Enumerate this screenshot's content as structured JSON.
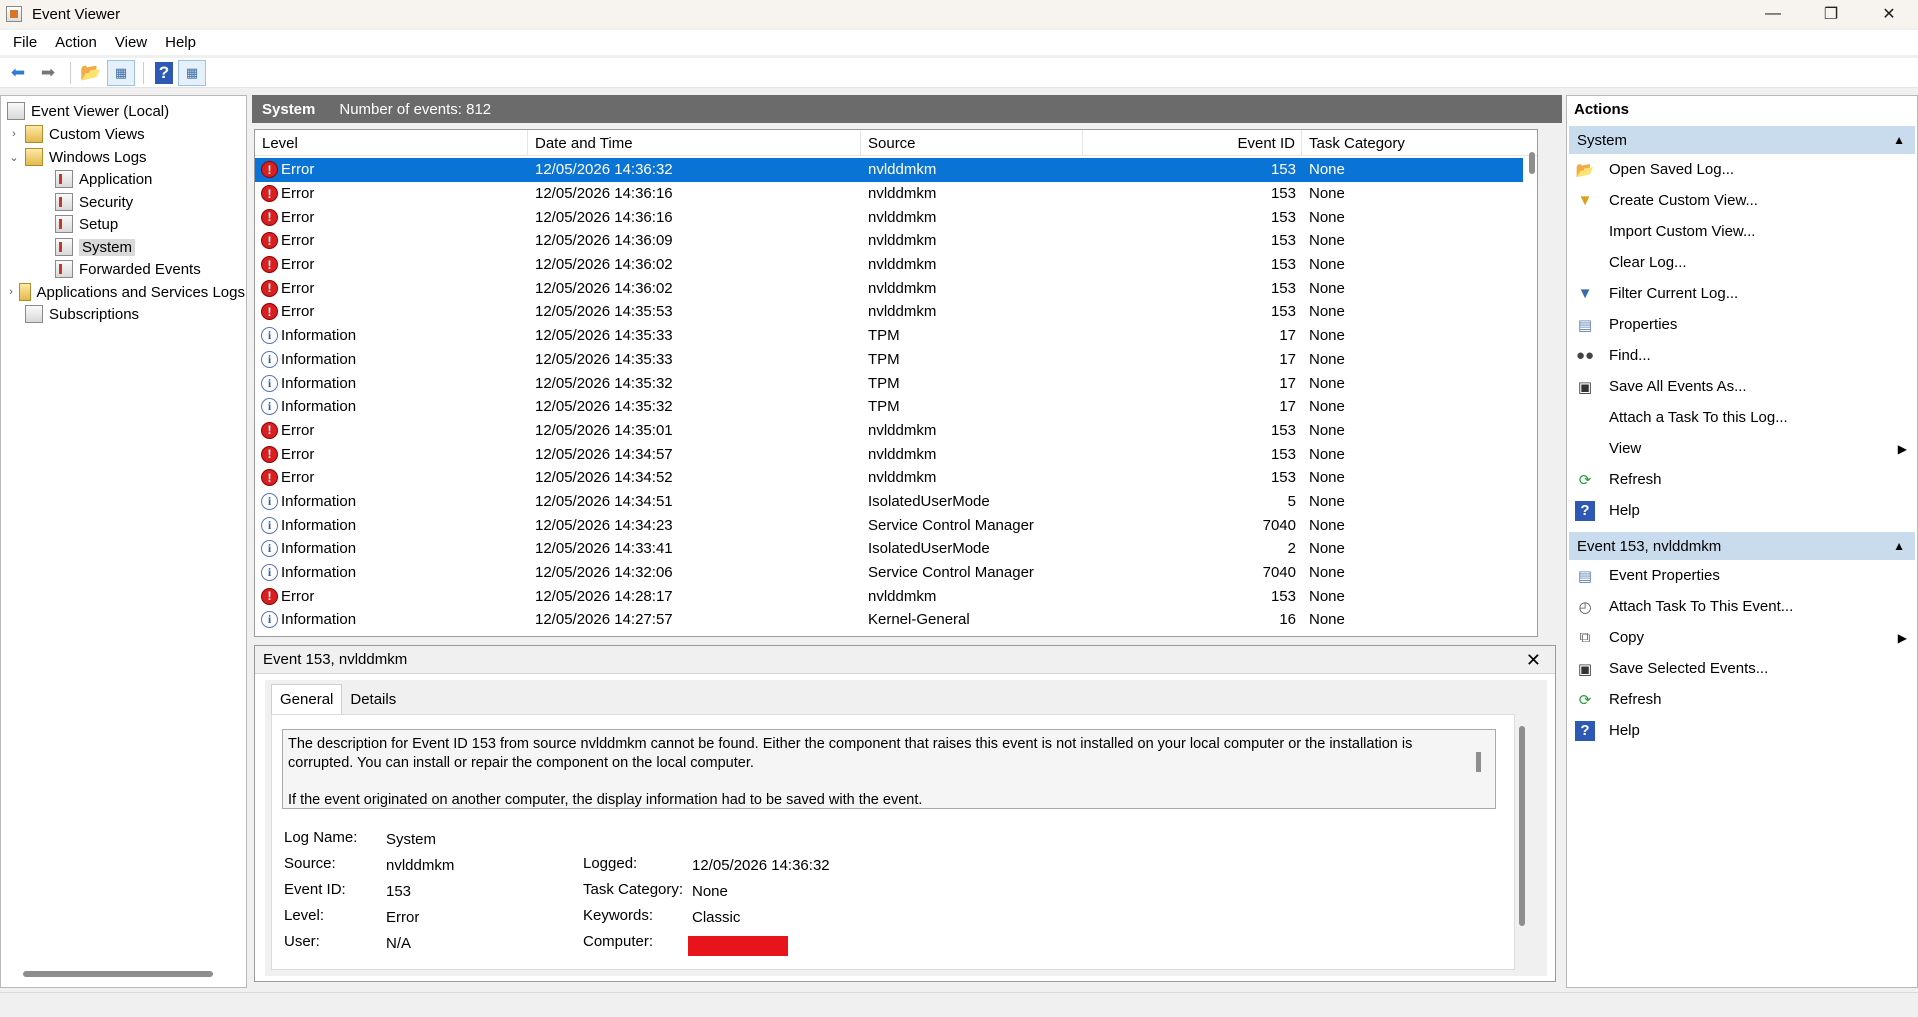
{
  "window": {
    "title": "Event Viewer"
  },
  "menu": [
    "File",
    "Action",
    "View",
    "Help"
  ],
  "tree": {
    "items": [
      {
        "label": "Event Viewer (Local)",
        "level": 0,
        "expander": "",
        "icon": "event-viewer-icon"
      },
      {
        "label": "Custom Views",
        "level": 1,
        "expander": "›",
        "icon": "folder-icon"
      },
      {
        "label": "Windows Logs",
        "level": 1,
        "expander": "⌄",
        "icon": "folder-icon"
      },
      {
        "label": "Application",
        "level": 2,
        "expander": "",
        "icon": "log-icon"
      },
      {
        "label": "Security",
        "level": 2,
        "expander": "",
        "icon": "log-icon"
      },
      {
        "label": "Setup",
        "level": 2,
        "expander": "",
        "icon": "log-icon"
      },
      {
        "label": "System",
        "level": 2,
        "expander": "",
        "icon": "log-icon",
        "selected": true
      },
      {
        "label": "Forwarded Events",
        "level": 2,
        "expander": "",
        "icon": "log-icon"
      },
      {
        "label": "Applications and Services Logs",
        "level": 1,
        "expander": "›",
        "icon": "folder-icon"
      },
      {
        "label": "Subscriptions",
        "level": 1,
        "expander": "",
        "icon": "subscriptions-icon"
      }
    ]
  },
  "center": {
    "title": "System",
    "count_text": "Number of events: 812",
    "columns": [
      "Level",
      "Date and Time",
      "Source",
      "Event ID",
      "Task Category"
    ],
    "rows": [
      {
        "level": "Error",
        "datetime": "12/05/2026 14:36:32",
        "source": "nvlddmkm",
        "id": "153",
        "category": "None",
        "selected": true
      },
      {
        "level": "Error",
        "datetime": "12/05/2026 14:36:16",
        "source": "nvlddmkm",
        "id": "153",
        "category": "None"
      },
      {
        "level": "Error",
        "datetime": "12/05/2026 14:36:16",
        "source": "nvlddmkm",
        "id": "153",
        "category": "None"
      },
      {
        "level": "Error",
        "datetime": "12/05/2026 14:36:09",
        "source": "nvlddmkm",
        "id": "153",
        "category": "None"
      },
      {
        "level": "Error",
        "datetime": "12/05/2026 14:36:02",
        "source": "nvlddmkm",
        "id": "153",
        "category": "None"
      },
      {
        "level": "Error",
        "datetime": "12/05/2026 14:36:02",
        "source": "nvlddmkm",
        "id": "153",
        "category": "None"
      },
      {
        "level": "Error",
        "datetime": "12/05/2026 14:35:53",
        "source": "nvlddmkm",
        "id": "153",
        "category": "None"
      },
      {
        "level": "Information",
        "datetime": "12/05/2026 14:35:33",
        "source": "TPM",
        "id": "17",
        "category": "None"
      },
      {
        "level": "Information",
        "datetime": "12/05/2026 14:35:33",
        "source": "TPM",
        "id": "17",
        "category": "None"
      },
      {
        "level": "Information",
        "datetime": "12/05/2026 14:35:32",
        "source": "TPM",
        "id": "17",
        "category": "None"
      },
      {
        "level": "Information",
        "datetime": "12/05/2026 14:35:32",
        "source": "TPM",
        "id": "17",
        "category": "None"
      },
      {
        "level": "Error",
        "datetime": "12/05/2026 14:35:01",
        "source": "nvlddmkm",
        "id": "153",
        "category": "None"
      },
      {
        "level": "Error",
        "datetime": "12/05/2026 14:34:57",
        "source": "nvlddmkm",
        "id": "153",
        "category": "None"
      },
      {
        "level": "Error",
        "datetime": "12/05/2026 14:34:52",
        "source": "nvlddmkm",
        "id": "153",
        "category": "None"
      },
      {
        "level": "Information",
        "datetime": "12/05/2026 14:34:51",
        "source": "IsolatedUserMode",
        "id": "5",
        "category": "None"
      },
      {
        "level": "Information",
        "datetime": "12/05/2026 14:34:23",
        "source": "Service Control Manager",
        "id": "7040",
        "category": "None"
      },
      {
        "level": "Information",
        "datetime": "12/05/2026 14:33:41",
        "source": "IsolatedUserMode",
        "id": "2",
        "category": "None"
      },
      {
        "level": "Information",
        "datetime": "12/05/2026 14:32:06",
        "source": "Service Control Manager",
        "id": "7040",
        "category": "None"
      },
      {
        "level": "Error",
        "datetime": "12/05/2026 14:28:17",
        "source": "nvlddmkm",
        "id": "153",
        "category": "None"
      },
      {
        "level": "Information",
        "datetime": "12/05/2026 14:27:57",
        "source": "Kernel-General",
        "id": "16",
        "category": "None"
      }
    ]
  },
  "detail": {
    "title": "Event 153, nvlddmkm",
    "tabs": [
      "General",
      "Details"
    ],
    "description_1": "The description for Event ID 153 from source nvlddmkm cannot be found. Either the component that raises this event is not installed on your local computer or the installation is corrupted. You can install or repair the component on the local computer.",
    "description_2": "If the event originated on another computer, the display information had to be saved with the event.",
    "labels": {
      "log_name": "Log Name:",
      "source": "Source:",
      "event_id": "Event ID:",
      "level": "Level:",
      "user": "User:",
      "logged": "Logged:",
      "task_category": "Task Category:",
      "keywords": "Keywords:",
      "computer": "Computer:"
    },
    "values": {
      "log_name": "System",
      "source": "nvlddmkm",
      "event_id": "153",
      "level": "Error",
      "user": "N/A",
      "logged": "12/05/2026 14:36:32",
      "task_category": "None",
      "keywords": "Classic"
    },
    "redaction_color": "#e8141c"
  },
  "actions": {
    "title": "Actions",
    "section1": {
      "title": "System",
      "items": [
        {
          "label": "Open Saved Log...",
          "icon": "open-folder-icon",
          "submenu": false
        },
        {
          "label": "Create Custom View...",
          "icon": "funnel-icon",
          "submenu": false
        },
        {
          "label": "Import Custom View...",
          "icon": "",
          "submenu": false
        },
        {
          "label": "Clear Log...",
          "icon": "",
          "submenu": false
        },
        {
          "label": "Filter Current Log...",
          "icon": "filter-icon",
          "submenu": false
        },
        {
          "label": "Properties",
          "icon": "properties-icon",
          "submenu": false
        },
        {
          "label": "Find...",
          "icon": "binoculars-icon",
          "submenu": false
        },
        {
          "label": "Save All Events As...",
          "icon": "save-icon",
          "submenu": false
        },
        {
          "label": "Attach a Task To this Log...",
          "icon": "",
          "submenu": false
        },
        {
          "label": "View",
          "icon": "",
          "submenu": true
        },
        {
          "label": "Refresh",
          "icon": "refresh-icon",
          "submenu": false
        },
        {
          "label": "Help",
          "icon": "help-icon",
          "submenu": false
        }
      ]
    },
    "section2": {
      "title": "Event 153, nvlddmkm",
      "items": [
        {
          "label": "Event Properties",
          "icon": "properties-icon",
          "submenu": false
        },
        {
          "label": "Attach Task To This Event...",
          "icon": "task-icon",
          "submenu": false
        },
        {
          "label": "Copy",
          "icon": "copy-icon",
          "submenu": true
        },
        {
          "label": "Save Selected Events...",
          "icon": "save-icon",
          "submenu": false
        },
        {
          "label": "Refresh",
          "icon": "refresh-icon",
          "submenu": false
        },
        {
          "label": "Help",
          "icon": "help-icon",
          "submenu": false
        }
      ]
    }
  },
  "colors": {
    "selection": "#0a74d6",
    "section_header": "#c9dced",
    "pane_header": "#6b6b6b",
    "error": "#d82020",
    "info": "#3a5da8"
  }
}
